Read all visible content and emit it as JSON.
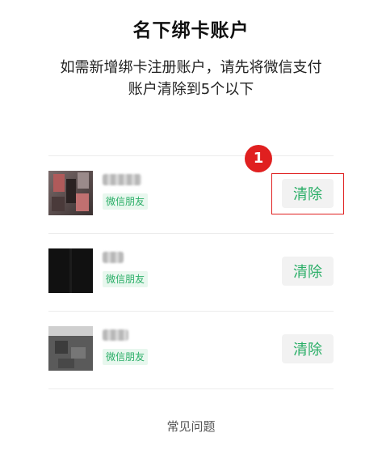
{
  "header": {
    "title": "名下绑卡账户",
    "description_line1": "如需新增绑卡注册账户，请先将微信支付",
    "description_line2": "账户清除到5个以下"
  },
  "accounts": [
    {
      "tag": "微信朋友",
      "clear_label": "清除"
    },
    {
      "tag": "微信朋友",
      "clear_label": "清除"
    },
    {
      "tag": "微信朋友",
      "clear_label": "清除"
    }
  ],
  "annotation": {
    "step_number": "1",
    "color": "#e02020"
  },
  "footer": {
    "faq_label": "常见问题"
  },
  "colors": {
    "accent_green": "#2aae67",
    "button_bg": "#f2f2f2"
  }
}
